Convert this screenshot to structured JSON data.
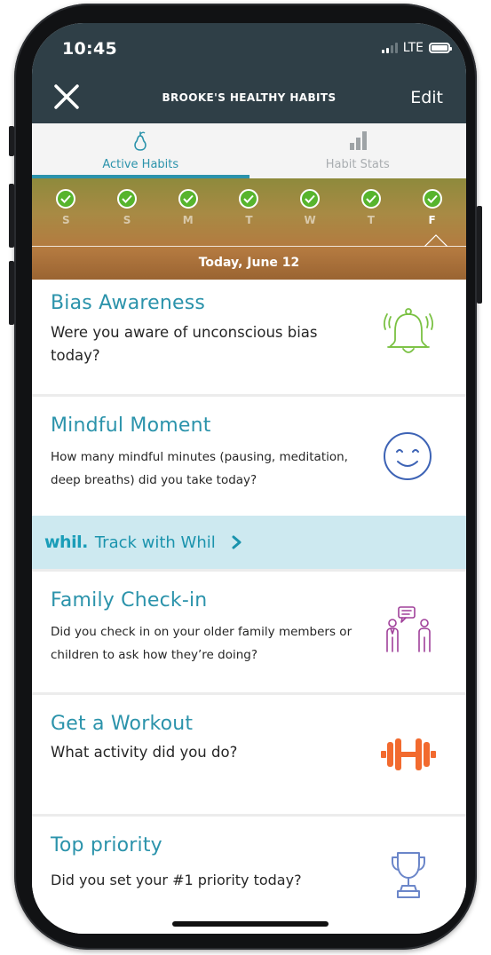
{
  "status_bar": {
    "time": "10:45",
    "network": "LTE"
  },
  "header": {
    "title": "BROOKE'S HEALTHY HABITS",
    "edit_label": "Edit",
    "close_icon": "close-icon"
  },
  "tabs": [
    {
      "label": "Active Habits",
      "icon": "pear-icon",
      "active": true
    },
    {
      "label": "Habit Stats",
      "icon": "bar-chart-icon",
      "active": false
    }
  ],
  "week": {
    "days": [
      "S",
      "S",
      "M",
      "T",
      "W",
      "T",
      "F"
    ],
    "selected_day": "F",
    "today_label": "Today, June 12"
  },
  "habits": [
    {
      "title": "Bias Awareness",
      "question": "Were you aware of unconscious bias today?",
      "icon": "bell-icon",
      "icon_color": "#7ac143"
    },
    {
      "title": "Mindful Moment",
      "question": "How many mindful minutes (pausing, meditation, deep breaths) did you take today?",
      "icon": "smiley-icon",
      "icon_color": "#3d63b5"
    },
    {
      "title": "Family Check-in",
      "question": "Did you check in on your older family members or children to ask how they’re doing?",
      "icon": "family-chat-icon",
      "icon_color": "#a0409a"
    },
    {
      "title": "Get a Workout",
      "question": "What activity did you do?",
      "icon": "dumbbell-icon",
      "icon_color": "#f26a2e"
    },
    {
      "title": "Top priority",
      "question": "Did you set your #1 priority today?",
      "icon": "trophy-icon",
      "icon_color": "#6b86c9"
    }
  ],
  "whil": {
    "logo": "whil.",
    "label": "Track with Whil"
  },
  "colors": {
    "header_bg": "#2f3f47",
    "accent": "#2b93ab",
    "check_green": "#57b42d",
    "whil_bg": "#cde9f0"
  }
}
